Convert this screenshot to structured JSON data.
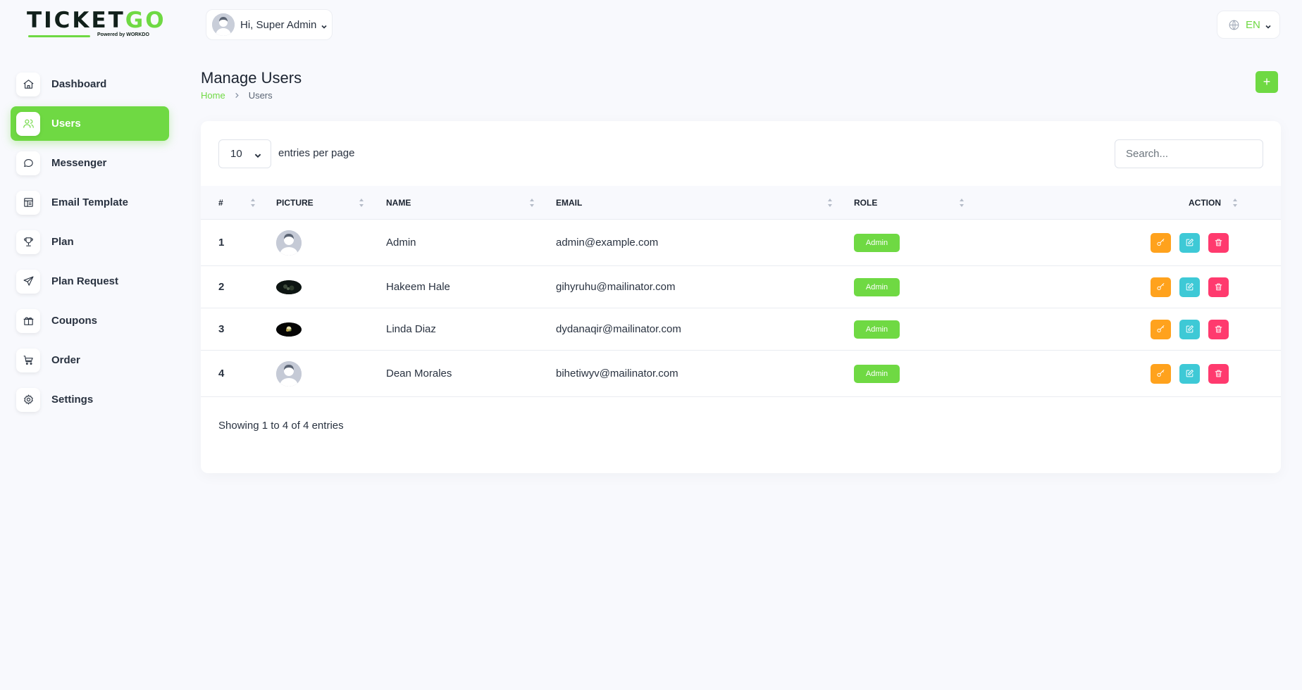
{
  "brand": {
    "name_a": "TICKET",
    "name_b": "GO",
    "tagline": "Powered by WORKDO"
  },
  "header": {
    "greeting": "Hi, Super Admin",
    "language": "EN"
  },
  "sidebar": {
    "items": [
      {
        "label": "Dashboard",
        "icon": "home-icon"
      },
      {
        "label": "Users",
        "icon": "users-icon",
        "active": true
      },
      {
        "label": "Messenger",
        "icon": "chat-icon"
      },
      {
        "label": "Email Template",
        "icon": "template-icon"
      },
      {
        "label": "Plan",
        "icon": "trophy-icon"
      },
      {
        "label": "Plan Request",
        "icon": "send-icon"
      },
      {
        "label": "Coupons",
        "icon": "gift-icon"
      },
      {
        "label": "Order",
        "icon": "cart-icon"
      },
      {
        "label": "Settings",
        "icon": "gear-icon"
      }
    ]
  },
  "page": {
    "title": "Manage Users",
    "breadcrumb": {
      "home": "Home",
      "current": "Users"
    },
    "add_label": "+"
  },
  "table": {
    "entries_value": "10",
    "entries_label": "entries per page",
    "search_placeholder": "Search...",
    "columns": {
      "num": "#",
      "picture": "PICTURE",
      "name": "NAME",
      "email": "EMAIL",
      "role": "ROLE",
      "action": "ACTION"
    },
    "rows": [
      {
        "num": "1",
        "name": "Admin",
        "email": "admin@example.com",
        "role": "Admin",
        "picture": "placeholder"
      },
      {
        "num": "2",
        "name": "Hakeem Hale",
        "email": "gihyruhu@mailinator.com",
        "role": "Admin",
        "picture": "photo"
      },
      {
        "num": "3",
        "name": "Linda Diaz",
        "email": "dydanaqir@mailinator.com",
        "role": "Admin",
        "picture": "photo"
      },
      {
        "num": "4",
        "name": "Dean Morales",
        "email": "bihetiwyv@mailinator.com",
        "role": "Admin",
        "picture": "placeholder"
      }
    ],
    "footer": "Showing 1 to 4 of 4 entries"
  },
  "colors": {
    "accent": "#6fd943",
    "warning": "#ffa21d",
    "info": "#3ec9d6",
    "danger": "#ff3a6e"
  }
}
